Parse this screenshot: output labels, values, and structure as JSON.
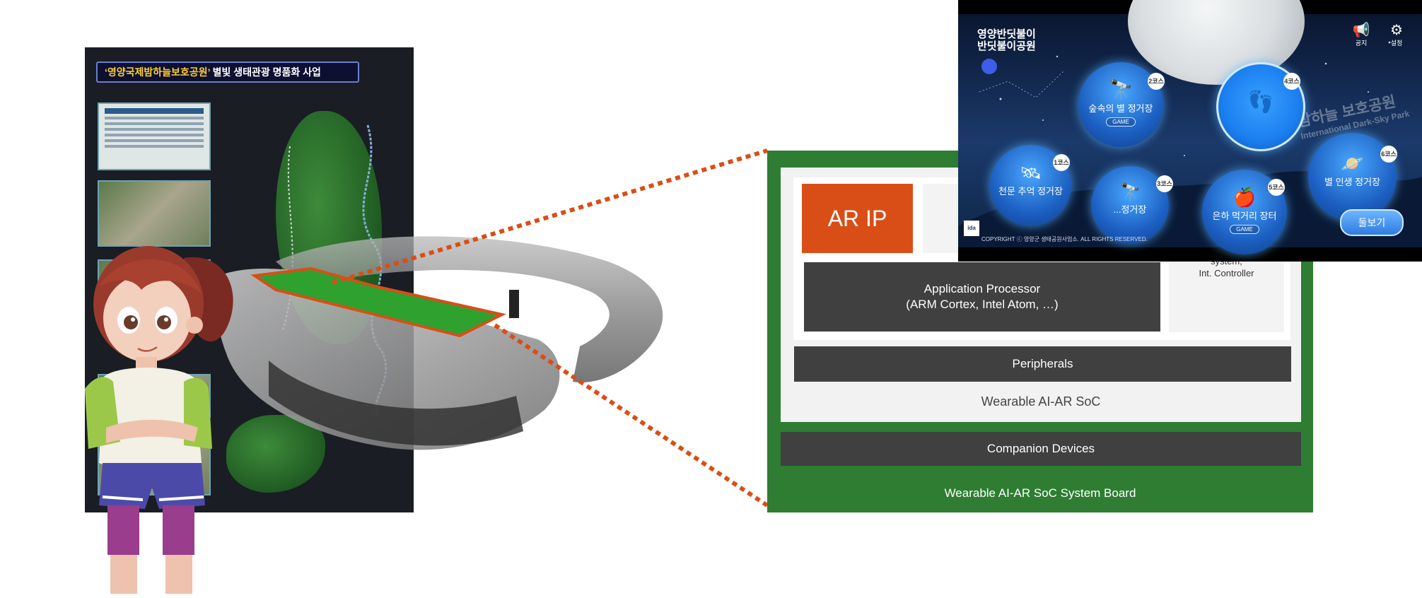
{
  "poster": {
    "title_highlight": "‘영양국제밤하늘보호공원’",
    "title_rest": " 별빛 생태관광 명품화 사업"
  },
  "board": {
    "ar_ip": "AR IP",
    "app_processor_line1": "Application Processor",
    "app_processor_line2": "(ARM Cortex, Intel Atom, …)",
    "controller_line1": "system,",
    "controller_line2": "Int. Controller",
    "peripherals": "Peripherals",
    "soc_label": "Wearable AI-AR SoC",
    "companion": "Companion Devices",
    "board_label": "Wearable AI-AR SoC System Board"
  },
  "app": {
    "logo_line1": "영양반딧불이",
    "logo_line2": "반딧불이공원",
    "notice_label": "공지",
    "settings_label": "설정",
    "watermark": "밤하늘 보호공원",
    "watermark2": "International Dark-Sky Park",
    "copyright": "COPYRIGHT ⓒ 영양군 생태공원사업소. ALL RIGHTS RESERVED.",
    "cta": "둘보기",
    "courses": [
      {
        "badge": "2코스",
        "label": "숲속의 별 정거장",
        "game": "GAME"
      },
      {
        "badge": "4코스",
        "label": "",
        "game": ""
      },
      {
        "badge": "1코스",
        "label": "천문 추억 정거장",
        "game": ""
      },
      {
        "badge": "3코스",
        "label": "...정거장",
        "game": ""
      },
      {
        "badge": "5코스",
        "label": "은하 먹거리 장터",
        "game": "GAME"
      },
      {
        "badge": "6코스",
        "label": "별 인생 정거장",
        "game": ""
      }
    ]
  }
}
